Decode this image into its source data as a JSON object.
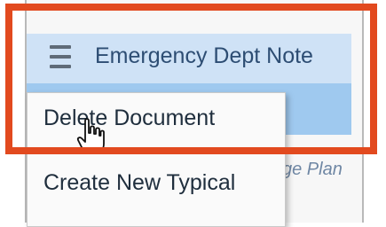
{
  "header": {
    "title": "Emergency Dept Note",
    "menu_icon": "hamburger-menu-icon"
  },
  "context_menu": {
    "items": [
      {
        "label": "Delete Document"
      },
      {
        "label": "Create New Typical"
      }
    ]
  },
  "background_text": "ge Plan",
  "colors": {
    "highlight_border": "#e24a1f",
    "header_bg": "#cfe2f6",
    "band_bg": "#9fc9ef",
    "title_text": "#2d4d73"
  }
}
